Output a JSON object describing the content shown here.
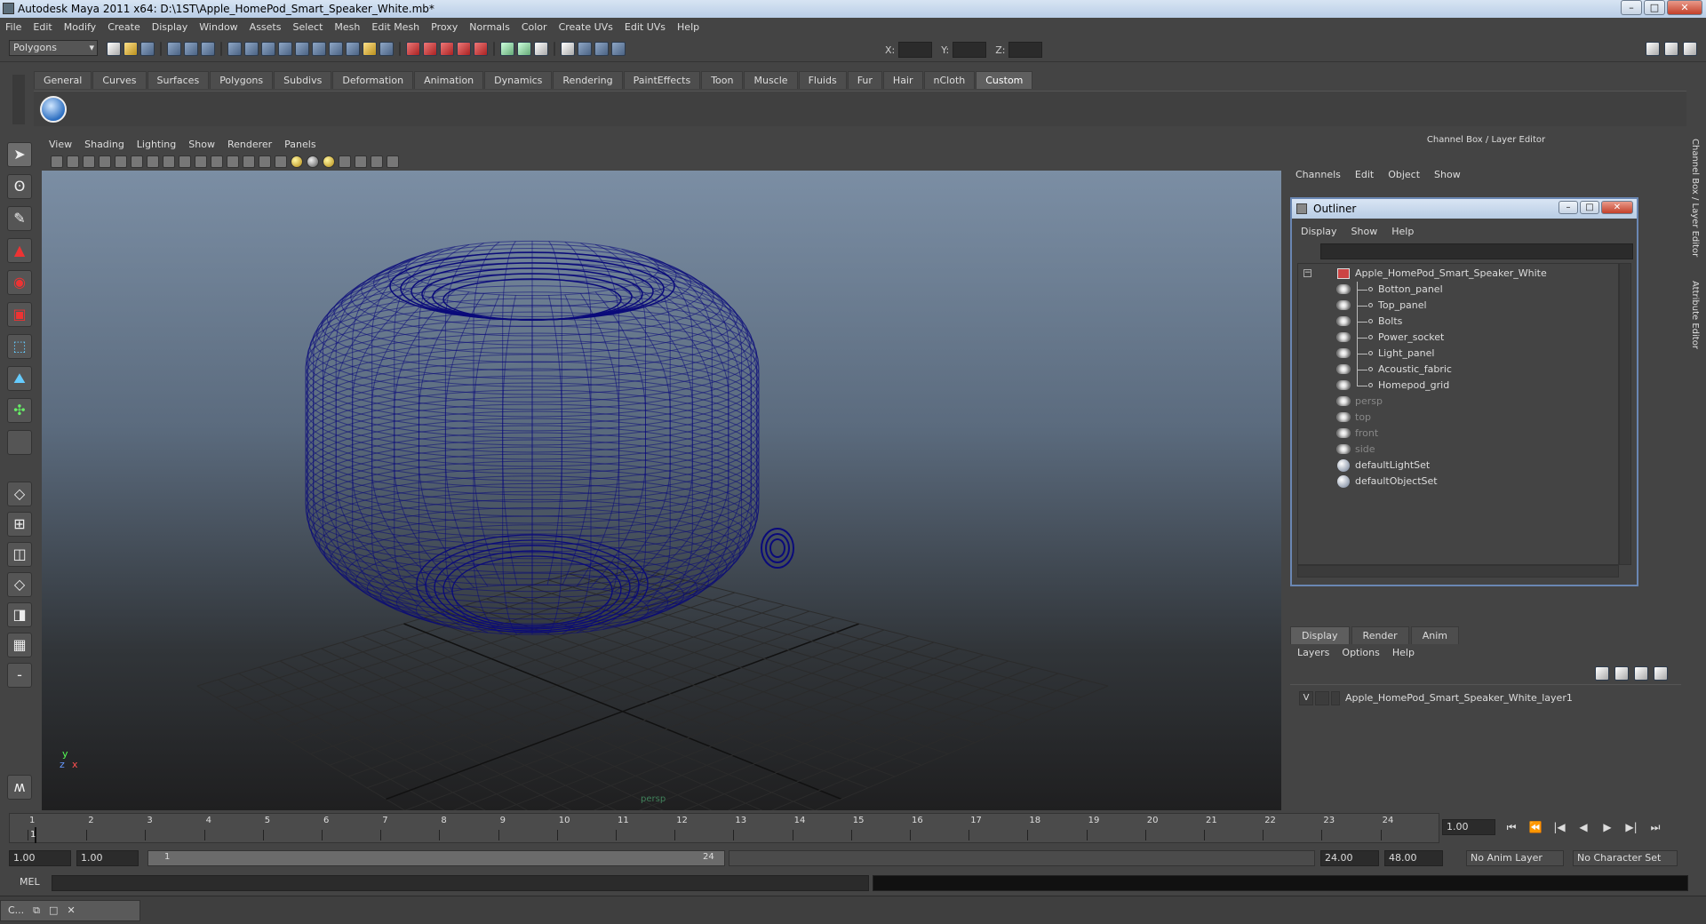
{
  "window": {
    "title": "Autodesk Maya 2011 x64: D:\\1ST\\Apple_HomePod_Smart_Speaker_White.mb*",
    "minimize": "–",
    "maximize": "□",
    "close": "✕"
  },
  "menus": [
    "File",
    "Edit",
    "Modify",
    "Create",
    "Display",
    "Window",
    "Assets",
    "Select",
    "Mesh",
    "Edit Mesh",
    "Proxy",
    "Normals",
    "Color",
    "Create UVs",
    "Edit UVs",
    "Help"
  ],
  "status": {
    "mode": "Polygons",
    "x_label": "X:",
    "y_label": "Y:",
    "z_label": "Z:"
  },
  "shelf": {
    "tabs": [
      "General",
      "Curves",
      "Surfaces",
      "Polygons",
      "Subdivs",
      "Deformation",
      "Animation",
      "Dynamics",
      "Rendering",
      "PaintEffects",
      "Toon",
      "Muscle",
      "Fluids",
      "Fur",
      "Hair",
      "nCloth",
      "Custom"
    ],
    "active": "Custom"
  },
  "viewport": {
    "menu": [
      "View",
      "Shading",
      "Lighting",
      "Show",
      "Renderer",
      "Panels"
    ],
    "camera": "persp",
    "axis_y": "y",
    "axis_x": "x",
    "axis_z": "z",
    "wire_color": "#0a0a7a"
  },
  "channel_box": {
    "title": "Channel Box / Layer Editor",
    "menu": [
      "Channels",
      "Edit",
      "Object",
      "Show"
    ],
    "side_tabs": [
      "Channel Box / Layer Editor",
      "Attribute Editor"
    ]
  },
  "outliner": {
    "title": "Outliner",
    "menu": [
      "Display",
      "Show",
      "Help"
    ],
    "root": "Apple_HomePod_Smart_Speaker_White",
    "children": [
      "Botton_panel",
      "Top_panel",
      "Bolts",
      "Power_socket",
      "Light_panel",
      "Acoustic_fabric",
      "Homepod_grid"
    ],
    "cameras": [
      "persp",
      "top",
      "front",
      "side"
    ],
    "sets": [
      "defaultLightSet",
      "defaultObjectSet"
    ]
  },
  "layers": {
    "tabs": [
      "Display",
      "Render",
      "Anim"
    ],
    "active_tab": "Display",
    "menu": [
      "Layers",
      "Options",
      "Help"
    ],
    "rows": [
      {
        "visible": "V",
        "name": "Apple_HomePod_Smart_Speaker_White_layer1"
      }
    ]
  },
  "timeline": {
    "ticks": [
      "1",
      "2",
      "3",
      "4",
      "5",
      "6",
      "7",
      "8",
      "9",
      "10",
      "11",
      "12",
      "13",
      "14",
      "15",
      "16",
      "17",
      "18",
      "19",
      "20",
      "21",
      "22",
      "23",
      "24"
    ],
    "current_frame": "1",
    "current_field": "1.00"
  },
  "playback": [
    "⏮",
    "⏪",
    "|◀",
    "◀",
    "▶",
    "▶|",
    "⏭"
  ],
  "range": {
    "start": "1.00",
    "playback_start": "1.00",
    "bar_start": "1",
    "bar_end": "24",
    "playback_end": "24.00",
    "end": "48.00",
    "anim_layer": "No Anim Layer",
    "char_set": "No Character Set"
  },
  "cmd": {
    "label": "MEL"
  },
  "taskbar": {
    "mini_title": "C..."
  }
}
